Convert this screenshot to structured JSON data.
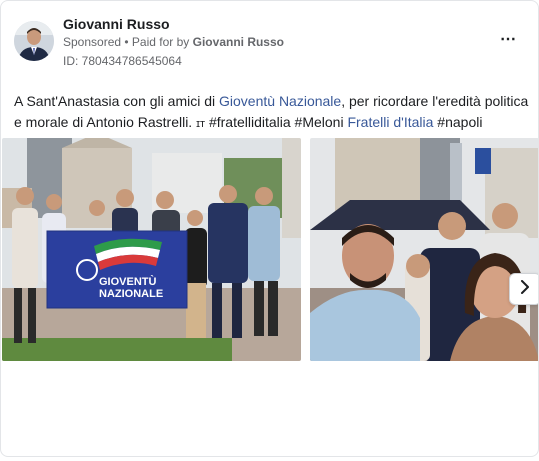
{
  "post": {
    "author": "Giovanni Russo",
    "sponsored_label": "Sponsored",
    "separator": " • ",
    "paid_for_prefix": "Paid for by",
    "paid_for_name": "Giovanni Russo",
    "id_label": "ID: 780434786545064",
    "more_icon": "⋯"
  },
  "body": {
    "t1": "A Sant'Anastasia con gli amici di ",
    "link1": "Gioventù Nazionale",
    "t2": ", per ricordare l'eredità politica e morale di Antonio Rastrelli. ",
    "flag": "ɪᴛ",
    "t3": " #fratelliditalia #Meloni ",
    "link2": "Fratelli d'Italia",
    "t4": " #napoli"
  },
  "banner": {
    "line1": "GIOVENTÙ",
    "line2": "NAZIONALE"
  },
  "colors": {
    "link": "#385898",
    "banner": "#2b3f9e",
    "sky": "#dfe3e6",
    "ground": "#b7a79a"
  }
}
